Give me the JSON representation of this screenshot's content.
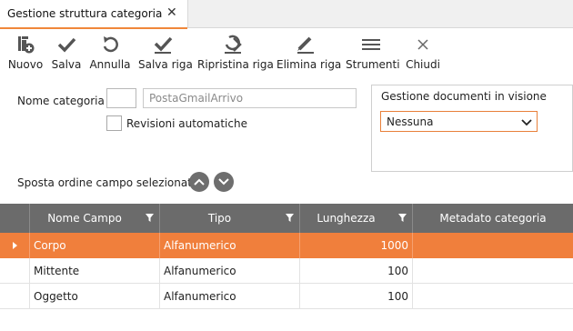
{
  "tab": {
    "title": "Gestione struttura categoria",
    "close": "✕"
  },
  "toolbar": {
    "nuovo": "Nuovo",
    "salva": "Salva",
    "annulla": "Annulla",
    "salva_riga": "Salva riga",
    "ripristina_riga": "Ripristina riga",
    "elimina_riga": "Elimina riga",
    "strumenti": "Strumenti",
    "chiudi": "Chiudi"
  },
  "form": {
    "nome_categoria_label": "Nome categoria",
    "nome_categoria_code": "",
    "nome_categoria_value": "PostaGmailArrivo",
    "revisioni_label": "Revisioni automatiche",
    "revisioni_checked": false,
    "gestione_label": "Gestione documenti in visione",
    "gestione_value": "Nessuna",
    "sposta_label": "Sposta ordine campo selezionato"
  },
  "grid": {
    "columns": [
      "Nome Campo",
      "Tipo",
      "Lunghezza",
      "Metadato categoria"
    ],
    "rows": [
      {
        "nome": "Corpo",
        "tipo": "Alfanumerico",
        "lunghezza": "1000",
        "metadato": "",
        "selected": true
      },
      {
        "nome": "Mittente",
        "tipo": "Alfanumerico",
        "lunghezza": "100",
        "metadato": "",
        "selected": false
      },
      {
        "nome": "Oggetto",
        "tipo": "Alfanumerico",
        "lunghezza": "100",
        "metadato": "",
        "selected": false
      }
    ]
  },
  "colors": {
    "accent": "#f07f3c",
    "header": "#6b6b6b",
    "icon": "#555555"
  }
}
